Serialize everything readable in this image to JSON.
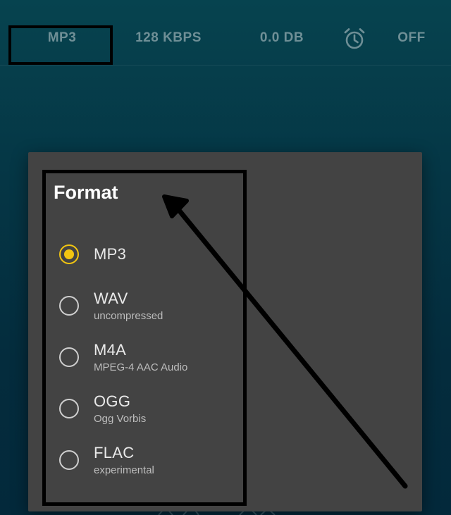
{
  "topbar": {
    "format": "MP3",
    "bitrate": "128 KBPS",
    "gain": "0.0 DB",
    "timer_icon": "alarm-clock-icon",
    "timer_value": "OFF"
  },
  "dialog": {
    "title": "Format",
    "options": [
      {
        "label": "MP3",
        "sublabel": "",
        "selected": true
      },
      {
        "label": "WAV",
        "sublabel": "uncompressed",
        "selected": false
      },
      {
        "label": "M4A",
        "sublabel": "MPEG-4 AAC Audio",
        "selected": false
      },
      {
        "label": "OGG",
        "sublabel": "Ogg Vorbis",
        "selected": false
      },
      {
        "label": "FLAC",
        "sublabel": "experimental",
        "selected": false
      }
    ]
  },
  "colors": {
    "background_top": "#06434f",
    "background_bottom": "#03293b",
    "dialog_bg": "#434343",
    "radio_selected": "#f2c511",
    "topbar_text": "#6f8f96",
    "annotation": "#000000"
  }
}
